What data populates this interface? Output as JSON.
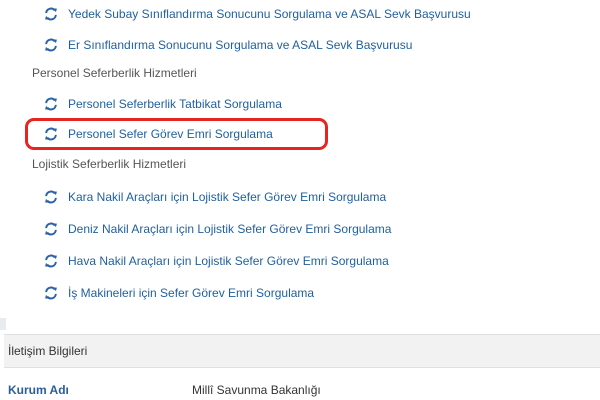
{
  "links": {
    "yedek_subay": "Yedek Subay Sınıflandırma Sonucunu Sorgulama ve ASAL Sevk Başvurusu",
    "er_siniflandirma": "Er Sınıflandırma Sonucunu Sorgulama ve ASAL Sevk Başvurusu",
    "personel_tatbikat": "Personel Seferberlik Tatbikat Sorgulama",
    "personel_sefer_gorev": "Personel Sefer Görev Emri Sorgulama",
    "kara_nakil": "Kara Nakil Araçları için Lojistik Sefer Görev Emri Sorgulama",
    "deniz_nakil": "Deniz Nakil Araçları için Lojistik Sefer Görev Emri Sorgulama",
    "hava_nakil": "Hava Nakil Araçları için Lojistik Sefer Görev Emri Sorgulama",
    "is_makineleri": "İş Makineleri için Sefer Görev Emri Sorgulama"
  },
  "sections": {
    "personel": "Personel Seferberlik Hizmetleri",
    "lojistik": "Lojistik Seferberlik Hizmetleri"
  },
  "contact": {
    "header": "İletişim Bilgileri",
    "kurum_key": "Kurum Adı",
    "kurum_value": "Millî Savunma Bakanlığı"
  },
  "colors": {
    "link": "#1f5f9f",
    "icon": "#2a63a8",
    "highlight": "#e62420"
  },
  "icons": {
    "refresh": "refresh-arrows-icon"
  }
}
